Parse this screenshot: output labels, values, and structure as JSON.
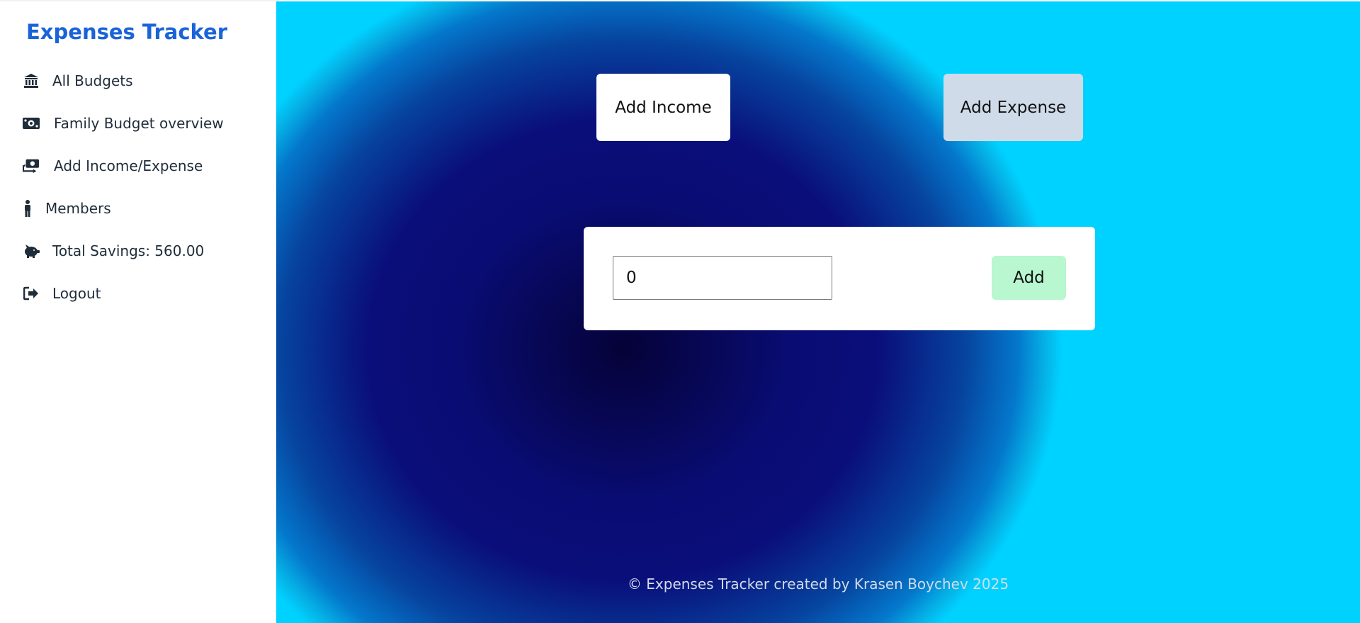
{
  "sidebar": {
    "brand": "Expenses Tracker",
    "items": [
      {
        "label": "All Budgets",
        "icon": "bank-icon"
      },
      {
        "label": "Family Budget overview",
        "icon": "money-bill-icon"
      },
      {
        "label": "Add Income/Expense",
        "icon": "money-exchange-icon"
      },
      {
        "label": "Members",
        "icon": "person-icon"
      },
      {
        "label": "Total Savings: 560.00",
        "icon": "piggy-bank-icon"
      },
      {
        "label": "Logout",
        "icon": "logout-icon"
      }
    ]
  },
  "main": {
    "add_income_label": "Add Income",
    "add_expense_label": "Add Expense",
    "amount_value": "0",
    "add_button_label": "Add",
    "footer": "© Expenses Tracker created by Krasen Boychev 2025"
  },
  "colors": {
    "brand": "#1a63d9",
    "text_dark": "#1f2c3a",
    "add_button_bg": "#b8f7cf",
    "expense_button_bg": "#cfdbe9",
    "background_center": "#050238",
    "background_edge": "#00d2ff"
  }
}
